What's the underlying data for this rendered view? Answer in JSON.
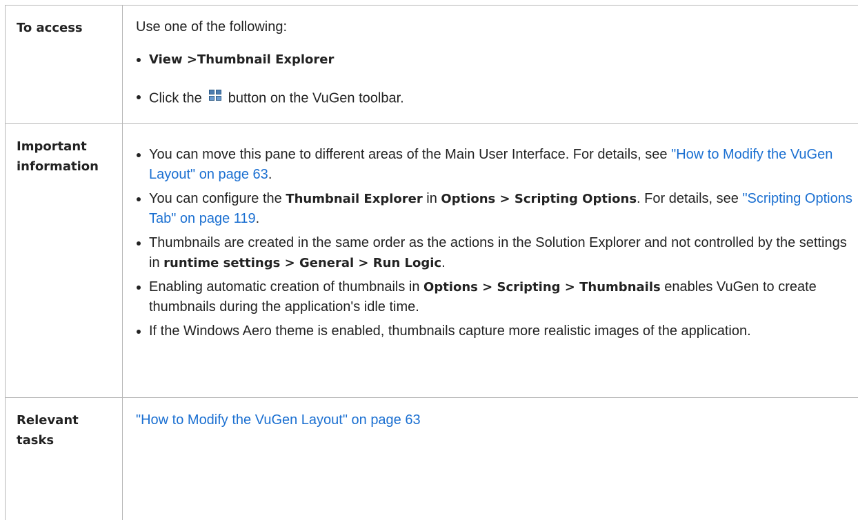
{
  "access": {
    "label": "To access",
    "intro": "Use one of the following:",
    "item1": "View >Thumbnail Explorer",
    "item2_pre": "Click the",
    "item2_icon": "thumbnail-explorer-icon",
    "item2_post": "button on the VuGen toolbar."
  },
  "important": {
    "label_line1": "Important",
    "label_line2": "information",
    "items": [
      {
        "t1": "You can move this pane to different areas of the Main User Interface. For details, see ",
        "link": "\"How to Modify the VuGen Layout\" on page 63",
        "t2": "."
      },
      {
        "t1": "You can configure the ",
        "b1": "Thumbnail Explorer",
        "t2": " in ",
        "b2": "Options > Scripting Options",
        "t3": ". For details, see ",
        "link": "\"Scripting Options Tab\" on page 119",
        "t4": "."
      },
      {
        "t1": "Thumbnails are created in the same order as the actions in the Solution Explorer and not controlled by the settings in ",
        "b1": "runtime settings > General > Run Logic",
        "t2": "."
      },
      {
        "t1": "Enabling automatic creation of thumbnails in ",
        "b1": "Options > Scripting > Thumbnails",
        "t2": " enables VuGen to create thumbnails during the application's idle time."
      },
      {
        "t1": "If the Windows Aero theme is enabled, thumbnails capture more realistic images of the application."
      }
    ]
  },
  "relevant": {
    "label_line1": "Relevant",
    "label_line2": "tasks",
    "link": "\"How to Modify the VuGen Layout\" on page 63"
  }
}
